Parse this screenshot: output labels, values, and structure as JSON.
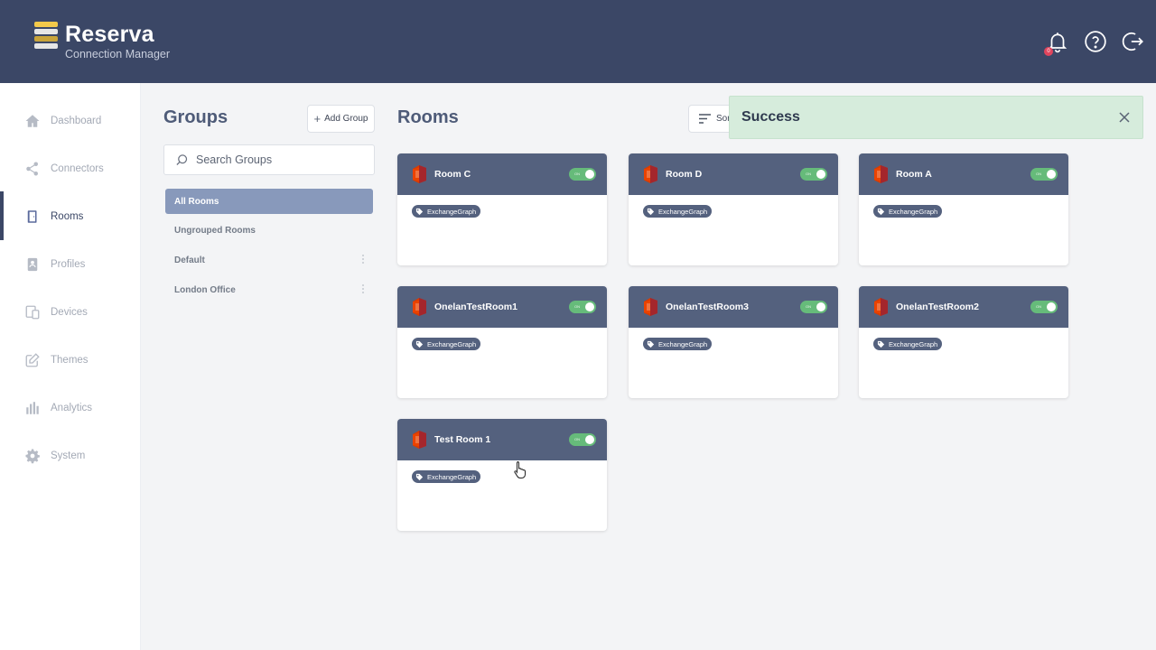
{
  "header": {
    "brand": "Reserva",
    "tagline": "Connection Manager",
    "notification_count": "0",
    "logo_colors": [
      "#f3c94a",
      "#e6e6e6",
      "#c9a43a",
      "#e6e6e6"
    ]
  },
  "sidebar": {
    "items": [
      {
        "label": "Dashboard",
        "icon": "home-icon"
      },
      {
        "label": "Connectors",
        "icon": "share-icon"
      },
      {
        "label": "Rooms",
        "icon": "door-icon",
        "active": true
      },
      {
        "label": "Profiles",
        "icon": "profile-icon"
      },
      {
        "label": "Devices",
        "icon": "devices-icon"
      },
      {
        "label": "Themes",
        "icon": "edit-icon"
      },
      {
        "label": "Analytics",
        "icon": "bar-chart-icon"
      },
      {
        "label": "System",
        "icon": "gear-icon"
      }
    ]
  },
  "groups": {
    "title": "Groups",
    "add_label": "Add Group",
    "search_placeholder": "Search Groups",
    "items": [
      {
        "label": "All Rooms",
        "selected": true
      },
      {
        "label": "Ungrouped Rooms"
      },
      {
        "label": "Default"
      },
      {
        "label": "London Office"
      }
    ]
  },
  "rooms": {
    "title": "Rooms",
    "sort_label": "Sort",
    "toggle_label": "ON",
    "cards": [
      {
        "name": "Room C",
        "tag": "ExchangeGraph"
      },
      {
        "name": "Room D",
        "tag": "ExchangeGraph"
      },
      {
        "name": "Room A",
        "tag": "ExchangeGraph"
      },
      {
        "name": "OnelanTestRoom1",
        "tag": "ExchangeGraph"
      },
      {
        "name": "OnelanTestRoom3",
        "tag": "ExchangeGraph"
      },
      {
        "name": "OnelanTestRoom2",
        "tag": "ExchangeGraph"
      },
      {
        "name": "Test Room 1",
        "tag": "ExchangeGraph"
      }
    ]
  },
  "toast": {
    "message": "Success"
  },
  "colors": {
    "header": "#3b4766",
    "card_header": "#54617e",
    "toggle_on": "#66bb7a",
    "toast_bg": "#d6ecdc",
    "selected_group": "#8899bb"
  }
}
